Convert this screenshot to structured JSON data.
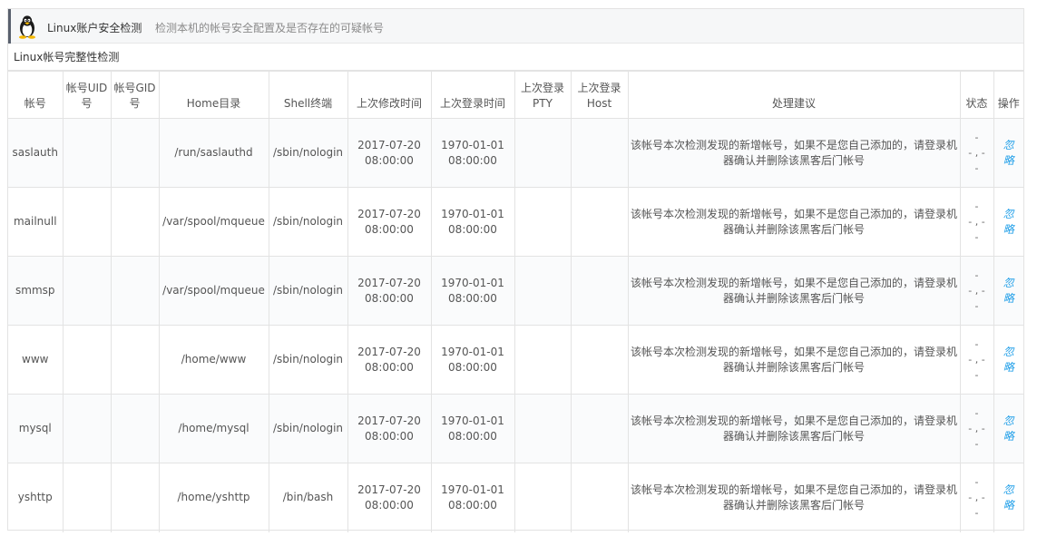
{
  "header": {
    "title": "Linux账户安全检测",
    "description": "检测本机的帐号安全配置及是否存在的可疑帐号",
    "icon": "tux-penguin-icon",
    "accent_color": "#59606d"
  },
  "section": {
    "title": "Linux帐号完整性检测"
  },
  "table": {
    "columns": {
      "account": "帐号",
      "uid": "帐号UID号",
      "gid": "帐号GID号",
      "home": "Home目录",
      "shell": "Shell终端",
      "modify_time": "上次修改时间",
      "login_time": "上次登录时间",
      "pty": "上次登录PTY",
      "host": "上次登录Host",
      "advice": "处理建议",
      "status": "状态",
      "operation": "操作"
    },
    "rows": [
      {
        "account": "saslauth",
        "uid": "",
        "gid": "",
        "home": "/run/saslauthd",
        "shell": "/sbin/nologin",
        "modify_date": "2017-07-20",
        "modify_clock": "08:00:00",
        "login_date": "1970-01-01",
        "login_clock": "08:00:00",
        "pty": "",
        "host": "",
        "advice": "该帐号本次检测发现的新增帐号，如果不是您自己添加的，请登录机器确认并删除该黑客后门帐号",
        "status_top": "-",
        "status_mid": "- , -",
        "status_bottom": "-",
        "op": "忽略"
      },
      {
        "account": "mailnull",
        "uid": "",
        "gid": "",
        "home": "/var/spool/mqueue",
        "shell": "/sbin/nologin",
        "modify_date": "2017-07-20",
        "modify_clock": "08:00:00",
        "login_date": "1970-01-01",
        "login_clock": "08:00:00",
        "pty": "",
        "host": "",
        "advice": "该帐号本次检测发现的新增帐号，如果不是您自己添加的，请登录机器确认并删除该黑客后门帐号",
        "status_top": "-",
        "status_mid": "- , -",
        "status_bottom": "-",
        "op": "忽略"
      },
      {
        "account": "smmsp",
        "uid": "",
        "gid": "",
        "home": "/var/spool/mqueue",
        "shell": "/sbin/nologin",
        "modify_date": "2017-07-20",
        "modify_clock": "08:00:00",
        "login_date": "1970-01-01",
        "login_clock": "08:00:00",
        "pty": "",
        "host": "",
        "advice": "该帐号本次检测发现的新增帐号，如果不是您自己添加的，请登录机器确认并删除该黑客后门帐号",
        "status_top": "-",
        "status_mid": "- , -",
        "status_bottom": "-",
        "op": "忽略"
      },
      {
        "account": "www",
        "uid": "",
        "gid": "",
        "home": "/home/www",
        "shell": "/sbin/nologin",
        "modify_date": "2017-07-20",
        "modify_clock": "08:00:00",
        "login_date": "1970-01-01",
        "login_clock": "08:00:00",
        "pty": "",
        "host": "",
        "advice": "该帐号本次检测发现的新增帐号，如果不是您自己添加的，请登录机器确认并删除该黑客后门帐号",
        "status_top": "-",
        "status_mid": "- , -",
        "status_bottom": "-",
        "op": "忽略"
      },
      {
        "account": "mysql",
        "uid": "",
        "gid": "",
        "home": "/home/mysql",
        "shell": "/sbin/nologin",
        "modify_date": "2017-07-20",
        "modify_clock": "08:00:00",
        "login_date": "1970-01-01",
        "login_clock": "08:00:00",
        "pty": "",
        "host": "",
        "advice": "该帐号本次检测发现的新增帐号，如果不是您自己添加的，请登录机器确认并删除该黑客后门帐号",
        "status_top": "-",
        "status_mid": "- , -",
        "status_bottom": "-",
        "op": "忽略"
      },
      {
        "account": "yshttp",
        "uid": "",
        "gid": "",
        "home": "/home/yshttp",
        "shell": "/bin/bash",
        "modify_date": "2017-07-20",
        "modify_clock": "08:00:00",
        "login_date": "1970-01-01",
        "login_clock": "08:00:00",
        "pty": "",
        "host": "",
        "advice": "该帐号本次检测发现的新增帐号，如果不是您自己添加的，请登录机器确认并删除该黑客后门帐号",
        "status_top": "-",
        "status_mid": "- , -",
        "status_bottom": "-",
        "op": "忽略"
      }
    ]
  },
  "colors": {
    "link": "#1e9ee8",
    "border": "#e3e3e3",
    "header_bg": "#f6f7f8",
    "text": "#555555"
  }
}
